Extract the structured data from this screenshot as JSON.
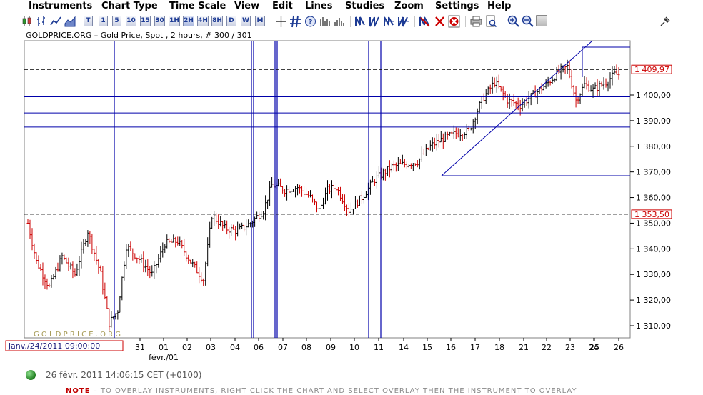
{
  "menubar": {
    "items": [
      "Instruments",
      "Chart Type",
      "Time Scale",
      "View",
      "Edit",
      "Lines",
      "Studies",
      "Zoom",
      "Settings",
      "Help"
    ]
  },
  "toolbar": {
    "timescale_buttons": [
      "T",
      "1",
      "5",
      "10",
      "15",
      "30",
      "1H",
      "2H",
      "4H",
      "8H",
      "D",
      "W",
      "M"
    ]
  },
  "chart": {
    "title": "GOLDPRICE.ORG – Gold Price, Spot , 2 hours, # 300 / 301",
    "watermark": "G O L D P R I C E . O R G",
    "cursor_date_label": "janv./24/2011 09:00:00",
    "month_label": "févr./01",
    "price_tag_upper": "1 409,97",
    "price_tag_lower": "1 353,50"
  },
  "status": {
    "datetime": "26 févr. 2011 14:06:15  CET (+0100)"
  },
  "note": {
    "label": "NOTE",
    "text": " – TO OVERLAY INSTRUMENTS, RIGHT CLICK THE CHART AND SELECT OVERLAY THEN THE INSTRUMENT TO OVERLAY"
  },
  "colors": {
    "bar_up": "#000000",
    "bar_down": "#cc0000",
    "study_lines": "#0000aa",
    "price_tag_border": "#cc0000",
    "status_dot": "#1e7d1e"
  },
  "chart_data": {
    "type": "ohlc",
    "instrument": "Gold Price, Spot",
    "timeframe": "2 hours",
    "currency_axis": "right",
    "ylim": [
      1305,
      1420
    ],
    "y_ticks": [
      "1 310,00",
      "1 320,00",
      "1 330,00",
      "1 340,00",
      "1 350,00",
      "1 360,00",
      "1 370,00",
      "1 380,00",
      "1 390,00",
      "1 400,00"
    ],
    "y_tick_values": [
      1310,
      1320,
      1330,
      1340,
      1350,
      1360,
      1370,
      1380,
      1390,
      1400
    ],
    "x_ticks": [
      "31",
      "01",
      "02",
      "03",
      "04",
      "06",
      "07",
      "08",
      "09",
      "10",
      "11",
      "14",
      "15",
      "16",
      "17",
      "18",
      "21",
      "22",
      "23",
      "24",
      "25",
      "26"
    ],
    "horizontal_dashed_lines": [
      1409.97,
      1353.5
    ],
    "horizontal_solid_lines": [
      1399.3,
      1393.0,
      1387.5
    ],
    "vertical_lines_at_day": [
      "30",
      "04.7",
      "06.2",
      "10.7",
      "11.2"
    ],
    "trendline": {
      "from": [
        "15.6",
        1368.0
      ],
      "to": [
        "22.9",
        1421.0
      ]
    },
    "rectangle_top": 1417.5,
    "rectangle_bottom": 1368.0,
    "rectangle_from_day": "15.6",
    "fibo_top_from_day": "23.6",
    "anchors": [
      [
        0,
        1350
      ],
      [
        4,
        1335
      ],
      [
        10,
        1325
      ],
      [
        16,
        1337
      ],
      [
        22,
        1330
      ],
      [
        28,
        1347
      ],
      [
        34,
        1330
      ],
      [
        38,
        1311
      ],
      [
        42,
        1316
      ],
      [
        46,
        1341
      ],
      [
        52,
        1336
      ],
      [
        58,
        1330
      ],
      [
        64,
        1342
      ],
      [
        70,
        1343
      ],
      [
        76,
        1335
      ],
      [
        82,
        1328
      ],
      [
        86,
        1353
      ],
      [
        92,
        1348
      ],
      [
        98,
        1347
      ],
      [
        104,
        1350
      ],
      [
        110,
        1355
      ],
      [
        114,
        1365
      ],
      [
        120,
        1363
      ],
      [
        126,
        1364
      ],
      [
        132,
        1360
      ],
      [
        136,
        1355
      ],
      [
        140,
        1363
      ],
      [
        144,
        1364
      ],
      [
        150,
        1355
      ],
      [
        156,
        1360
      ],
      [
        162,
        1367
      ],
      [
        170,
        1372
      ],
      [
        176,
        1373
      ],
      [
        182,
        1374
      ],
      [
        188,
        1380
      ],
      [
        194,
        1383
      ],
      [
        200,
        1385
      ],
      [
        206,
        1386
      ],
      [
        212,
        1398
      ],
      [
        218,
        1405
      ],
      [
        224,
        1398
      ],
      [
        230,
        1396
      ],
      [
        236,
        1400
      ],
      [
        242,
        1404
      ],
      [
        248,
        1409
      ],
      [
        252,
        1411
      ],
      [
        256,
        1398
      ],
      [
        260,
        1404
      ],
      [
        264,
        1402
      ],
      [
        270,
        1405
      ],
      [
        274,
        1408
      ]
    ]
  }
}
